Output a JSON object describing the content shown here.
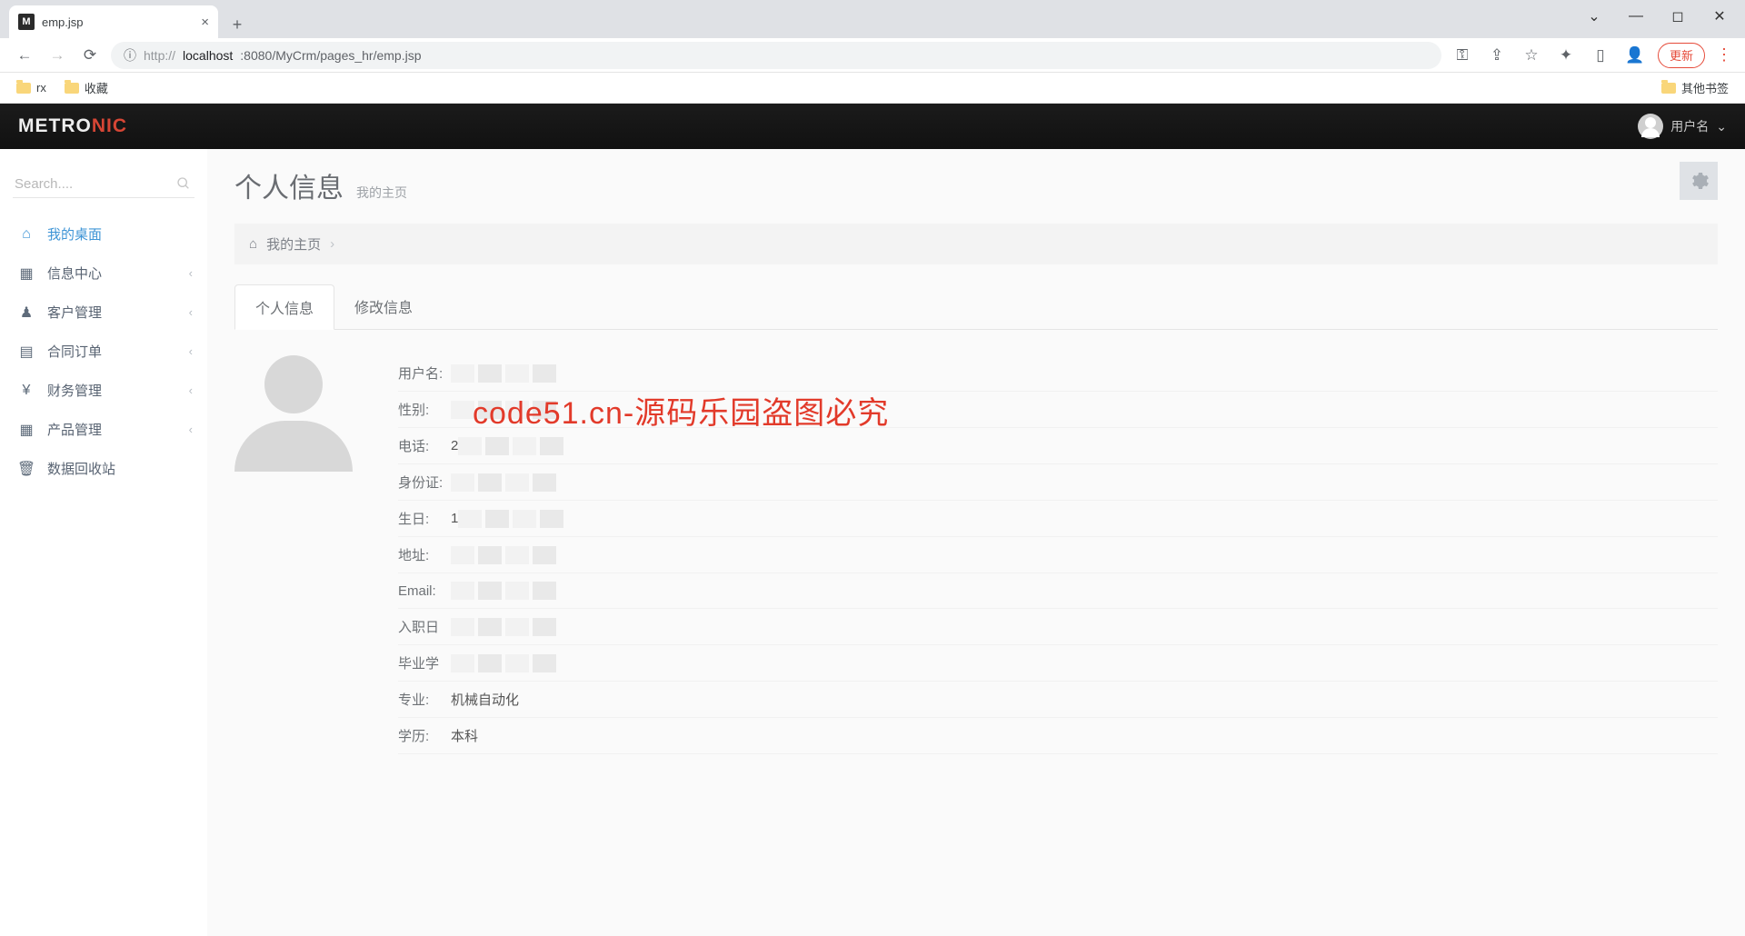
{
  "browser": {
    "tab_favicon": "M",
    "tab_title": "emp.jsp",
    "url_prefix": "http://",
    "url_host": "localhost",
    "url_port_path": ":8080/MyCrm/pages_hr/emp.jsp",
    "update_label": "更新",
    "bookmarks": [
      "rx",
      "收藏"
    ],
    "bookmarks_right": "其他书签"
  },
  "app": {
    "logo_a": "METRO",
    "logo_b": "NIC",
    "user_label": "用户名"
  },
  "sidebar": {
    "search_placeholder": "Search....",
    "items": [
      {
        "label": "我的桌面",
        "active": true,
        "expandable": false
      },
      {
        "label": "信息中心",
        "active": false,
        "expandable": true
      },
      {
        "label": "客户管理",
        "active": false,
        "expandable": true
      },
      {
        "label": "合同订单",
        "active": false,
        "expandable": true
      },
      {
        "label": "财务管理",
        "active": false,
        "expandable": true
      },
      {
        "label": "产品管理",
        "active": false,
        "expandable": true
      },
      {
        "label": "数据回收站",
        "active": false,
        "expandable": false
      }
    ]
  },
  "page": {
    "title": "个人信息",
    "subtitle": "我的主页",
    "breadcrumb": "我的主页",
    "tabs": [
      "个人信息",
      "修改信息"
    ],
    "watermark": "code51.cn-源码乐园盗图必究",
    "fields": [
      {
        "label": "用户名:",
        "blur": true
      },
      {
        "label": "性别:",
        "blur": true
      },
      {
        "label": "电话:",
        "prefix": "2",
        "blur": true
      },
      {
        "label": "身份证:",
        "blur": true
      },
      {
        "label": "生日:",
        "prefix": "1",
        "blur": true
      },
      {
        "label": "地址:",
        "blur": true
      },
      {
        "label": "Email:",
        "blur": true
      },
      {
        "label": "入职日",
        "blur": true
      },
      {
        "label": "毕业学",
        "blur": true
      },
      {
        "label": "专业:",
        "value": "机械自动化"
      },
      {
        "label": "学历:",
        "value": "本科"
      }
    ]
  }
}
